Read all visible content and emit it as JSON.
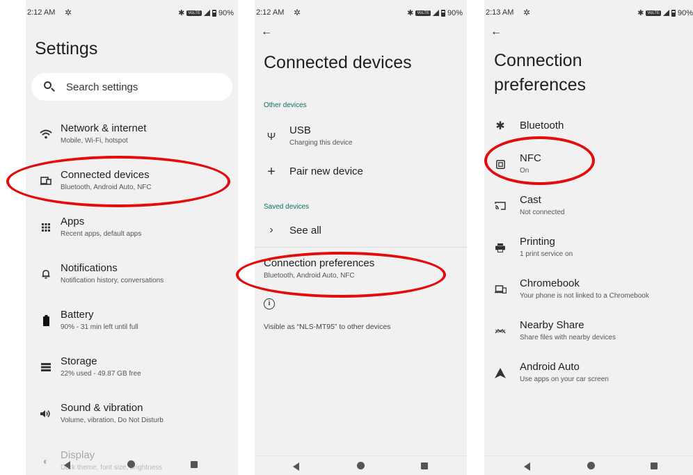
{
  "panel1": {
    "status": {
      "time": "2:12 AM",
      "battery": "90%"
    },
    "title": "Settings",
    "search": {
      "placeholder": "Search settings"
    },
    "items": [
      {
        "title": "Network & internet",
        "subtitle": "Mobile, Wi-Fi, hotspot",
        "icon": "wifi-icon"
      },
      {
        "title": "Connected devices",
        "subtitle": "Bluetooth, Android Auto, NFC",
        "icon": "connected-devices-icon"
      },
      {
        "title": "Apps",
        "subtitle": "Recent apps, default apps",
        "icon": "apps-grid-icon"
      },
      {
        "title": "Notifications",
        "subtitle": "Notification history, conversations",
        "icon": "bell-icon"
      },
      {
        "title": "Battery",
        "subtitle": "90% - 31 min left until full",
        "icon": "battery-icon"
      },
      {
        "title": "Storage",
        "subtitle": "22% used - 49.87 GB free",
        "icon": "storage-icon"
      },
      {
        "title": "Sound & vibration",
        "subtitle": "Volume, vibration, Do Not Disturb",
        "icon": "speaker-icon"
      },
      {
        "title": "Display",
        "subtitle": "Dark theme, font size, brightness",
        "icon": "display-icon"
      }
    ]
  },
  "panel2": {
    "status": {
      "time": "2:12 AM",
      "battery": "90%"
    },
    "title": "Connected devices",
    "other_devices_header": "Other devices",
    "usb": {
      "title": "USB",
      "subtitle": "Charging this device"
    },
    "pair_new": "Pair new device",
    "saved_devices_header": "Saved devices",
    "see_all": "See all",
    "connection_prefs": {
      "title": "Connection preferences",
      "subtitle": "Bluetooth, Android Auto, NFC"
    },
    "visible_as": "Visible as “NLS-MT95” to other devices"
  },
  "panel3": {
    "status": {
      "time": "2:13 AM",
      "battery": "90%"
    },
    "title_line1": "Connection",
    "title_line2": "preferences",
    "items": [
      {
        "title": "Bluetooth",
        "subtitle": "",
        "icon": "bluetooth-icon"
      },
      {
        "title": "NFC",
        "subtitle": "On",
        "icon": "nfc-icon"
      },
      {
        "title": "Cast",
        "subtitle": "Not connected",
        "icon": "cast-icon"
      },
      {
        "title": "Printing",
        "subtitle": "1 print service on",
        "icon": "printer-icon"
      },
      {
        "title": "Chromebook",
        "subtitle": "Your phone is not linked to a Chromebook",
        "icon": "chromebook-icon"
      },
      {
        "title": "Nearby Share",
        "subtitle": "Share files with nearby devices",
        "icon": "nearby-share-icon"
      },
      {
        "title": "Android Auto",
        "subtitle": "Use apps on your car screen",
        "icon": "android-auto-icon"
      }
    ]
  },
  "annotation_color": "#e30b0b"
}
